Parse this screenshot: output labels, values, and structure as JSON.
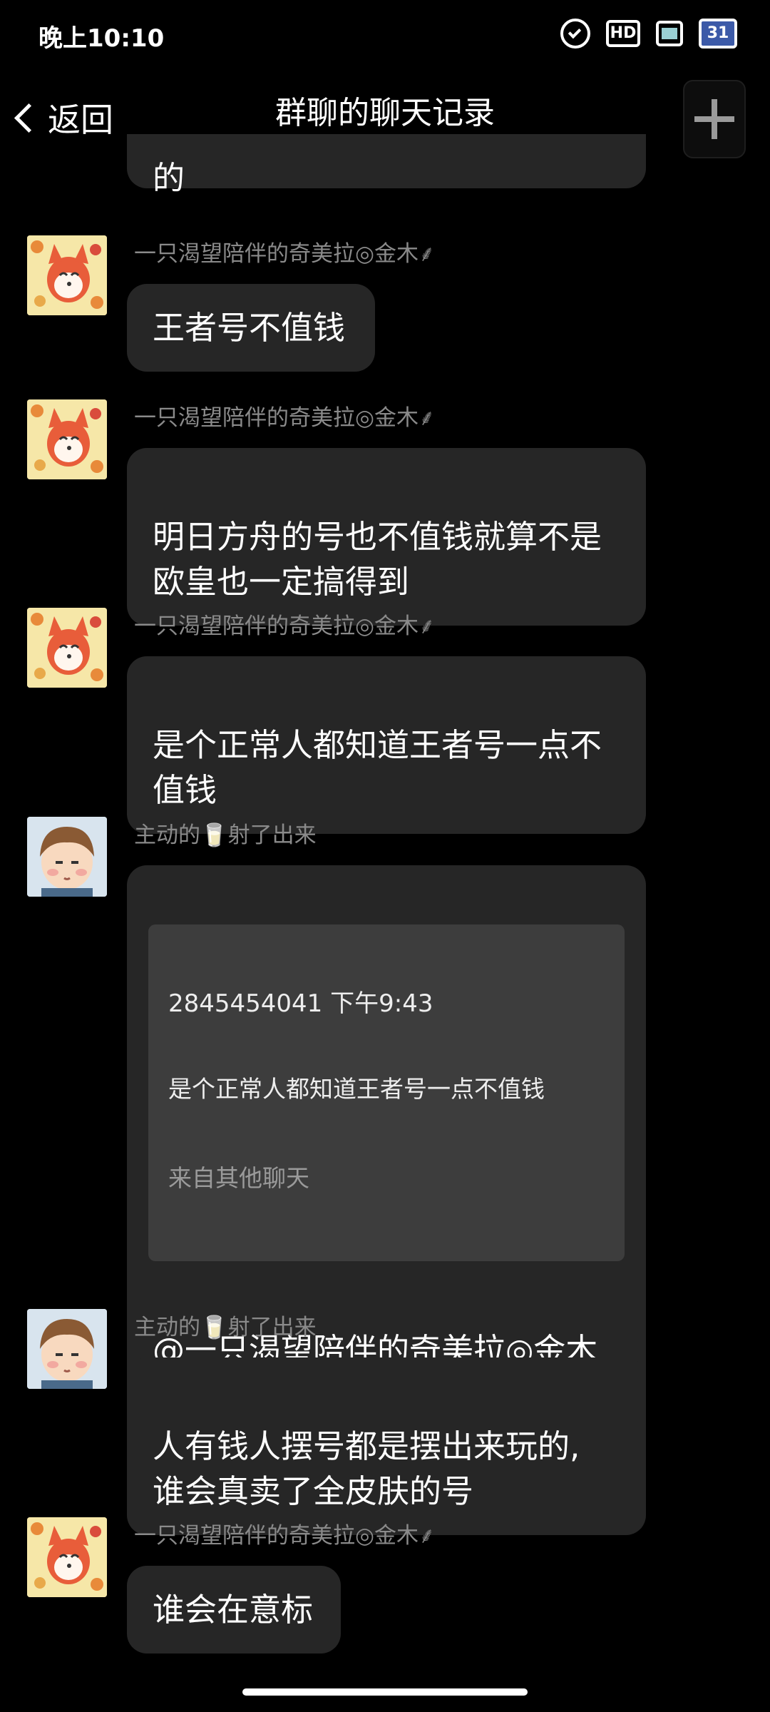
{
  "status_bar": {
    "time": "晚上10:10",
    "icons": [
      "alarm-icon",
      "hd-signal-icon",
      "battery-icon",
      "calendar-icon"
    ],
    "hd_label": "HD",
    "calendar_day": "31"
  },
  "nav": {
    "back_label": "返回",
    "title": "群聊的聊天记录",
    "add_icon": "plus-icon"
  },
  "messages": [
    {
      "sender": "",
      "text": "的"
    },
    {
      "sender": "一只渴望陪伴的奇美拉◎金木⸙",
      "text": "王者号不值钱"
    },
    {
      "sender": "一只渴望陪伴的奇美拉◎金木⸙",
      "text": "明日方舟的号也不值钱就算不是\n欧皇也一定搞得到"
    },
    {
      "sender": "一只渴望陪伴的奇美拉◎金木⸙",
      "text": "是个正常人都知道王者号一点不\n值钱"
    },
    {
      "sender": "主动的🥛射了出来",
      "quote": {
        "header": "2845454041 下午9:43",
        "text": "是个正常人都知道王者号一点不值钱",
        "source": "来自其他聊天"
      },
      "text": "@一只渴望陪伴的奇美拉◎金木\n⸙ @一只渴望陪伴的奇美拉◎金\n木⸙ 不值钱也不会也没你贬的那\n么夸张"
    },
    {
      "sender": "主动的🥛射了出来",
      "text": "人有钱人摆号都是摆出来玩的,\n谁会真卖了全皮肤的号"
    },
    {
      "sender": "一只渴望陪伴的奇美拉◎金木⸙",
      "text": "谁会在意标"
    }
  ]
}
